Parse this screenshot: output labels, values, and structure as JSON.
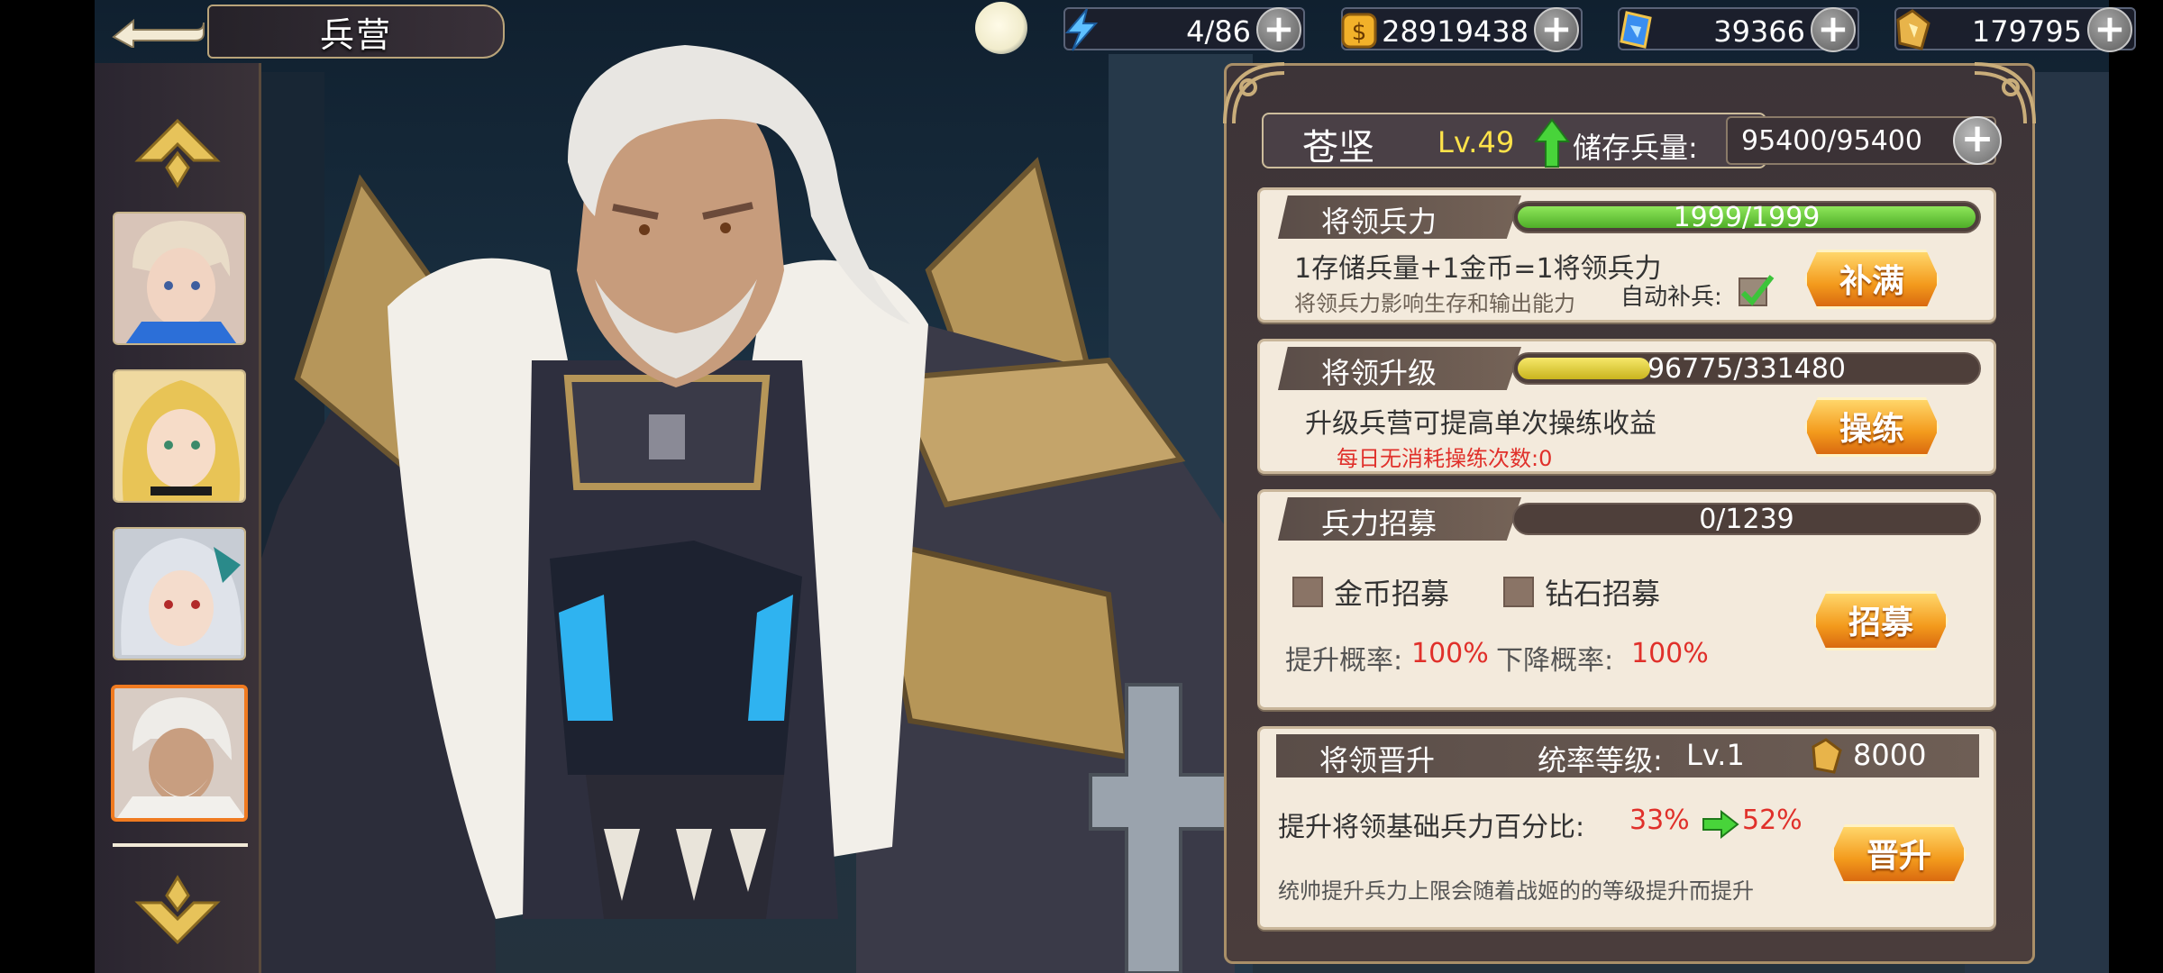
{
  "title": "兵营",
  "resources": [
    {
      "name": "energy",
      "icon": "lightning-icon",
      "value": "4/86"
    },
    {
      "name": "gold",
      "icon": "gold-coin-icon",
      "value": "28919438"
    },
    {
      "name": "diamond",
      "icon": "card-gem-icon",
      "value": "39366"
    },
    {
      "name": "honor",
      "icon": "gold-token-icon",
      "value": "179795"
    }
  ],
  "general": {
    "name": "苍坚",
    "level": "Lv.49",
    "store_label": "储存兵量:",
    "store_value": "95400/95400"
  },
  "troops": {
    "tab": "将领兵力",
    "progress_text": "1999/1999",
    "progress": 1.0,
    "desc": "1存储兵量+1金币=1将领兵力",
    "sub": "将领兵力影响生存和输出能力",
    "auto_label": "自动补兵:",
    "auto_checked": true,
    "button": "补满"
  },
  "upgrade": {
    "tab": "将领升级",
    "progress_text": "96775/331480",
    "progress": 0.29,
    "desc": "升级兵营可提高单次操练收益",
    "sub": "每日无消耗操练次数:0",
    "button": "操练"
  },
  "recruit": {
    "tab": "兵力招募",
    "progress_text": "0/1239",
    "progress": 0,
    "opt1": "金币招募",
    "opt2": "钻石招募",
    "up_label": "提升概率:",
    "up_value": "100%",
    "down_label": "下降概率:",
    "down_value": "100%",
    "button": "招募"
  },
  "promote": {
    "tab": "将领晋升",
    "command_label": "统率等级:",
    "command_value": "Lv.1",
    "cost": "8000",
    "desc": "提升将领基础兵力百分比:",
    "from": "33%",
    "to": "52%",
    "sub": "统帅提升兵力上限会随着战姬的的等级提升而提升",
    "button": "晋升"
  },
  "colors": {
    "accent_orange": "#f39a1c",
    "green_bar": "#6ccf3a",
    "yellow_bar": "#e8d43a",
    "red_text": "#e0302a"
  }
}
